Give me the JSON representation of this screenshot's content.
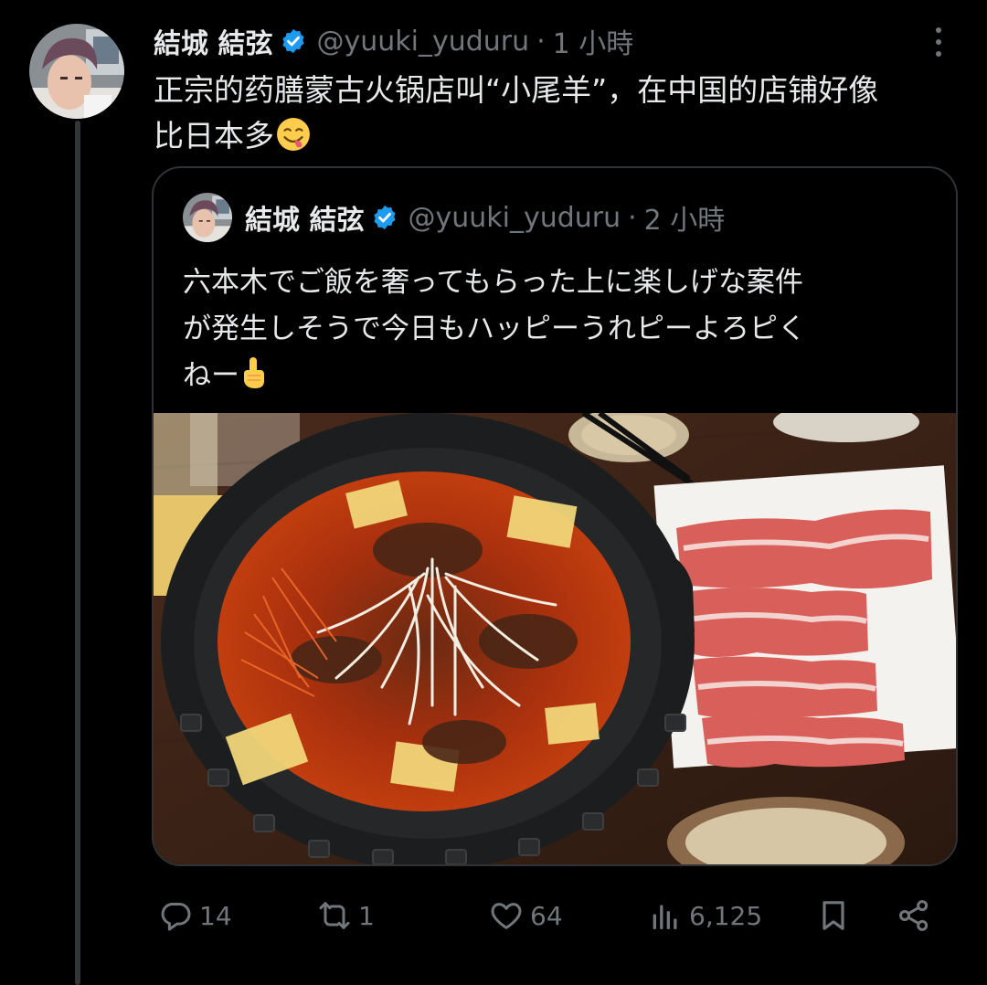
{
  "post": {
    "author_name": "結城 結弦",
    "handle": "@yuuki_yuduru",
    "separator": "·",
    "time": "1 小時",
    "text_line1": "正宗的药膳蒙古火锅店叫“小尾羊”，在中国的店铺好像",
    "text_line2": "比日本多"
  },
  "quote": {
    "author_name": "結城 結弦",
    "handle": "@yuuki_yuduru",
    "separator": "·",
    "time": "2 小時",
    "text_line1": "六本木でご飯を奢ってもらった上に楽しげな案件",
    "text_line2": "が発生しそうで今日もハッピーうれピーよろピく",
    "text_line3": "ねー"
  },
  "actions": {
    "replies": "14",
    "reposts": "1",
    "likes": "64",
    "views": "6,125"
  },
  "icons": {
    "verified": "verified-badge-icon",
    "more": "more-dots-icon",
    "reply": "reply-icon",
    "repost": "repost-icon",
    "like": "heart-icon",
    "views": "views-chart-icon",
    "bookmark": "bookmark-icon",
    "share": "share-icon"
  },
  "colors": {
    "background": "#000000",
    "text_primary": "#e7e9ea",
    "text_secondary": "#71767b",
    "verified_blue": "#1d9bf0",
    "border": "#2f3336"
  }
}
